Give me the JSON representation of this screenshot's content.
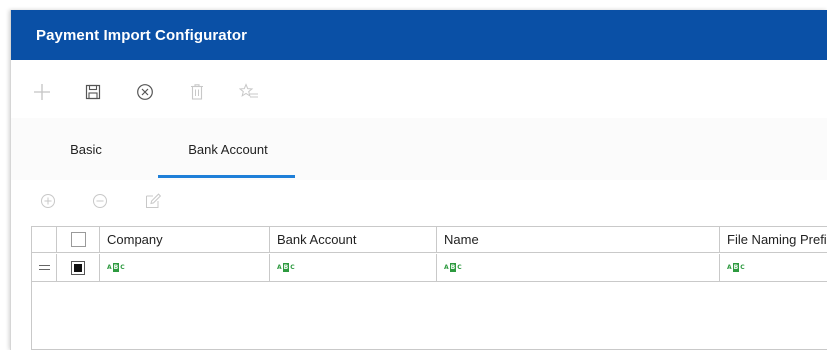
{
  "window": {
    "title": "Payment Import Configurator"
  },
  "toolbar": {
    "buttons": [
      {
        "name": "add",
        "icon": "plus-icon",
        "enabled": false
      },
      {
        "name": "save",
        "icon": "save-icon",
        "enabled": true
      },
      {
        "name": "cancel",
        "icon": "close-circle-icon",
        "enabled": true
      },
      {
        "name": "delete",
        "icon": "trash-icon",
        "enabled": false
      },
      {
        "name": "favorite",
        "icon": "star-list-icon",
        "enabled": false
      }
    ]
  },
  "tabs": [
    {
      "label": "Basic",
      "active": false
    },
    {
      "label": "Bank Account",
      "active": true
    }
  ],
  "grid_toolbar": {
    "buttons": [
      {
        "name": "add-row",
        "icon": "plus-circle-icon",
        "enabled": false
      },
      {
        "name": "remove-row",
        "icon": "minus-circle-icon",
        "enabled": false
      },
      {
        "name": "edit-row",
        "icon": "edit-icon",
        "enabled": false
      }
    ]
  },
  "grid": {
    "columns": [
      "Company",
      "Bank Account",
      "Name",
      "File Naming Prefix"
    ],
    "rows": [
      {
        "checked": true,
        "cells": [
          "ABC",
          "ABC",
          "ABC",
          "ABC"
        ]
      }
    ]
  },
  "colors": {
    "title_bar": "#0a50a6",
    "tab_underline": "#1e7fd8",
    "text_type_badge": "#2d9a3f"
  }
}
